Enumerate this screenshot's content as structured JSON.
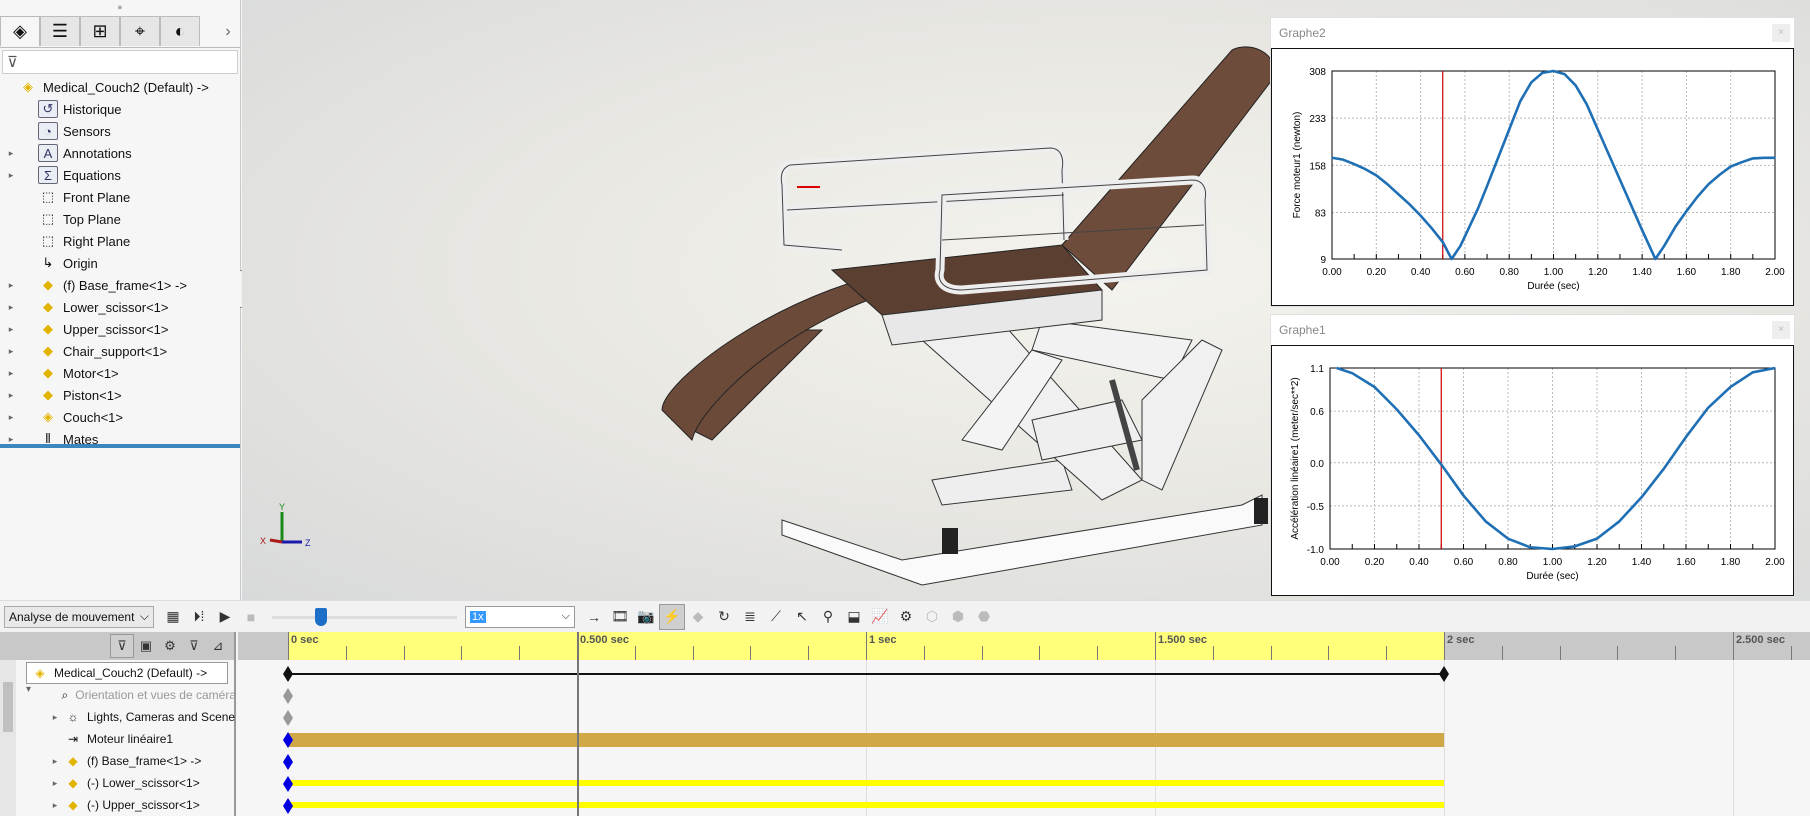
{
  "left_panel": {
    "tabs": [
      {
        "icon": "feature-manager-icon",
        "glyph": "◈"
      },
      {
        "icon": "property-manager-icon",
        "glyph": "☰"
      },
      {
        "icon": "configuration-manager-icon",
        "glyph": "⊞"
      },
      {
        "icon": "dimxpert-icon",
        "glyph": "⌖"
      },
      {
        "icon": "appearance-icon",
        "glyph": "◐"
      }
    ],
    "more_glyph": "›",
    "filter_glyph": "⊽",
    "tree": [
      {
        "label": "Medical_Couch2  (Default) ->",
        "icon": "assembly-icon",
        "glyph": "◈",
        "expand": "",
        "indent": 0
      },
      {
        "label": "Historique",
        "icon": "history-folder-icon",
        "glyph": "↺",
        "expand": "",
        "indent": 1
      },
      {
        "label": "Sensors",
        "icon": "sensors-folder-icon",
        "glyph": "◔",
        "expand": "",
        "indent": 1
      },
      {
        "label": "Annotations",
        "icon": "annotations-folder-icon",
        "glyph": "A",
        "expand": "▸",
        "indent": 1
      },
      {
        "label": "Equations",
        "icon": "equations-folder-icon",
        "glyph": "Σ",
        "expand": "▸",
        "indent": 1
      },
      {
        "label": "Front Plane",
        "icon": "plane-icon",
        "glyph": "⬚",
        "expand": "",
        "indent": 1
      },
      {
        "label": "Top Plane",
        "icon": "plane-icon",
        "glyph": "⬚",
        "expand": "",
        "indent": 1
      },
      {
        "label": "Right Plane",
        "icon": "plane-icon",
        "glyph": "⬚",
        "expand": "",
        "indent": 1
      },
      {
        "label": "Origin",
        "icon": "origin-icon",
        "glyph": "↳",
        "expand": "",
        "indent": 1
      },
      {
        "label": "(f) Base_frame<1> ->",
        "icon": "part-icon",
        "glyph": "◆",
        "expand": "▸",
        "indent": 1
      },
      {
        "label": "Lower_scissor<1>",
        "icon": "part-icon",
        "glyph": "◆",
        "expand": "▸",
        "indent": 1
      },
      {
        "label": "Upper_scissor<1>",
        "icon": "part-icon",
        "glyph": "◆",
        "expand": "▸",
        "indent": 1
      },
      {
        "label": "Chair_support<1>",
        "icon": "part-icon",
        "glyph": "◆",
        "expand": "▸",
        "indent": 1
      },
      {
        "label": "Motor<1>",
        "icon": "part-icon",
        "glyph": "◆",
        "expand": "▸",
        "indent": 1
      },
      {
        "label": "Piston<1>",
        "icon": "part-icon",
        "glyph": "◆",
        "expand": "▸",
        "indent": 1
      },
      {
        "label": "Couch<1>",
        "icon": "subassembly-icon",
        "glyph": "◈",
        "expand": "▸",
        "indent": 1
      },
      {
        "label": "Mates",
        "icon": "mates-icon",
        "glyph": "⫴",
        "expand": "▸",
        "indent": 1
      }
    ]
  },
  "graphs": {
    "g2": {
      "title": "Graphe2",
      "close": "×"
    },
    "g1": {
      "title": "Graphe1",
      "close": "×"
    }
  },
  "chart_data": [
    {
      "type": "line",
      "title": "Graphe2",
      "xlabel": "Durée (sec)",
      "ylabel": "Force moteur1 (newton)",
      "xlim": [
        0,
        2
      ],
      "ylim": [
        9,
        308
      ],
      "xticks": [
        "0.00",
        "0.20",
        "0.40",
        "0.60",
        "0.80",
        "1.00",
        "1.20",
        "1.40",
        "1.60",
        "1.80",
        "2.00"
      ],
      "yticks": [
        "9",
        "83",
        "158",
        "233",
        "308"
      ],
      "grid": true,
      "cursor_x": 0.5,
      "series": [
        {
          "name": "Force moteur1",
          "color": "#1f6fb5",
          "x": [
            0,
            0.05,
            0.1,
            0.15,
            0.2,
            0.25,
            0.3,
            0.35,
            0.4,
            0.45,
            0.5,
            0.54,
            0.58,
            0.62,
            0.66,
            0.7,
            0.75,
            0.8,
            0.85,
            0.9,
            0.95,
            1.0,
            1.05,
            1.1,
            1.15,
            1.2,
            1.25,
            1.3,
            1.35,
            1.4,
            1.46,
            1.5,
            1.55,
            1.6,
            1.65,
            1.7,
            1.75,
            1.8,
            1.85,
            1.9,
            1.95,
            2.0
          ],
          "y": [
            170,
            167,
            160,
            152,
            142,
            128,
            112,
            96,
            78,
            58,
            36,
            9,
            30,
            60,
            90,
            125,
            170,
            215,
            260,
            290,
            305,
            308,
            303,
            285,
            255,
            215,
            175,
            135,
            95,
            55,
            9,
            30,
            60,
            85,
            108,
            128,
            143,
            156,
            163,
            169,
            170,
            170
          ]
        }
      ]
    },
    {
      "type": "line",
      "title": "Graphe1",
      "xlabel": "Durée (sec)",
      "ylabel": "Accélération linéaire1 (meter/sec**2)",
      "xlim": [
        0,
        2
      ],
      "ylim": [
        -1.0,
        1.1
      ],
      "xticks": [
        "0.00",
        "0.20",
        "0.40",
        "0.60",
        "0.80",
        "1.00",
        "1.20",
        "1.40",
        "1.60",
        "1.80",
        "2.00"
      ],
      "yticks": [
        "-1.0",
        "-0.5",
        "0.0",
        "0.6",
        "1.1"
      ],
      "grid": true,
      "cursor_x": 0.5,
      "series": [
        {
          "name": "Accélération linéaire1",
          "color": "#1f6fb5",
          "x": [
            0.03,
            0.1,
            0.2,
            0.3,
            0.4,
            0.5,
            0.6,
            0.7,
            0.8,
            0.9,
            1.0,
            1.1,
            1.2,
            1.3,
            1.4,
            1.5,
            1.6,
            1.7,
            1.8,
            1.9,
            2.0
          ],
          "y": [
            1.1,
            1.04,
            0.88,
            0.62,
            0.32,
            -0.02,
            -0.38,
            -0.68,
            -0.88,
            -0.98,
            -1.0,
            -0.97,
            -0.88,
            -0.68,
            -0.4,
            -0.07,
            0.3,
            0.64,
            0.88,
            1.05,
            1.1
          ]
        }
      ]
    }
  ],
  "toolbar": {
    "study_type": "Analyse de mouvement",
    "dropdown_glyph": "⌵",
    "slider_fraction": 0.25,
    "speed": "1x",
    "buttons": [
      {
        "icon": "calculate-icon",
        "glyph": "▦"
      },
      {
        "icon": "play-from-start-icon",
        "glyph": "⏵⁞"
      },
      {
        "icon": "play-icon",
        "glyph": "▶"
      },
      {
        "icon": "stop-icon",
        "glyph": "■",
        "disabled": true
      }
    ],
    "buttons2": [
      {
        "icon": "playback-mode-icon",
        "glyph": "→"
      },
      {
        "icon": "save-animation-icon",
        "glyph": "🎞"
      },
      {
        "icon": "animation-wizard-icon",
        "glyph": "📷"
      },
      {
        "icon": "autokey-icon",
        "glyph": "⚡",
        "on": true
      },
      {
        "icon": "add-key-icon",
        "glyph": "◆",
        "disabled": true
      },
      {
        "icon": "motor-icon",
        "glyph": "↻"
      },
      {
        "icon": "spring-icon",
        "glyph": "≣"
      },
      {
        "icon": "damper-icon",
        "glyph": "⟋"
      },
      {
        "icon": "force-icon",
        "glyph": "↖"
      },
      {
        "icon": "contact-icon",
        "glyph": "⚲"
      },
      {
        "icon": "gravity-icon",
        "glyph": "⬓"
      },
      {
        "icon": "results-plots-icon",
        "glyph": "📈"
      },
      {
        "icon": "study-properties-icon",
        "glyph": "⚙"
      },
      {
        "icon": "collapse-icon",
        "glyph": "⬡",
        "disabled": true
      },
      {
        "icon": "expand-icon",
        "glyph": "⬢",
        "disabled": true
      },
      {
        "icon": "simulation-icon",
        "glyph": "⬣",
        "disabled": true
      }
    ]
  },
  "motion_tree": {
    "filters": [
      {
        "icon": "filter-animated-icon",
        "glyph": "⊽",
        "on": true
      },
      {
        "icon": "filter-driving-icon",
        "glyph": "▣"
      },
      {
        "icon": "filter-selected-icon",
        "glyph": "⚙"
      },
      {
        "icon": "filter-results-icon",
        "glyph": "⊽"
      },
      {
        "icon": "filter-plots-icon",
        "glyph": "⊿"
      }
    ],
    "rows": [
      {
        "label": "Medical_Couch2  (Default) ->",
        "icon": "assembly-icon",
        "glyph": "◈",
        "expand": "▾",
        "root": true,
        "key": "#111",
        "bar": "line"
      },
      {
        "label": "Orientation et vues de caméra",
        "icon": "camera-orientation-icon",
        "glyph": "⌕",
        "expand": "",
        "gray": true,
        "key": "#999",
        "bar": ""
      },
      {
        "label": "Lights, Cameras and Scene",
        "icon": "lights-folder-icon",
        "glyph": "☼",
        "expand": "▸",
        "key": "#999",
        "bar": ""
      },
      {
        "label": "Moteur linéaire1",
        "icon": "linear-motor-icon",
        "glyph": "⇥",
        "expand": "",
        "key": "#0000e0",
        "bar": "motor"
      },
      {
        "label": "(f) Base_frame<1> ->",
        "icon": "part-icon",
        "glyph": "◆",
        "expand": "▸",
        "key": "#0000e0",
        "bar": ""
      },
      {
        "label": "(-) Lower_scissor<1>",
        "icon": "part-icon",
        "glyph": "◆",
        "expand": "▸",
        "key": "#0000e0",
        "bar": "yellow"
      },
      {
        "label": "(-) Upper_scissor<1>",
        "icon": "part-icon",
        "glyph": "◆",
        "expand": "▸",
        "key": "#0000e0",
        "bar": "yellow"
      }
    ]
  },
  "timeline": {
    "labels": [
      "0 sec",
      "0.500 sec",
      "1 sec",
      "1.500 sec",
      "2 sec",
      "2.500 sec"
    ],
    "label_times": [
      0,
      0.5,
      1,
      1.5,
      2,
      2.5
    ],
    "study_end": 2,
    "current_time": 0.5,
    "colors": {
      "ruler_active": "#ffff7a",
      "motor_bar": "#d1a847",
      "part_bar": "#ffff00",
      "playhead": "#777777"
    }
  }
}
